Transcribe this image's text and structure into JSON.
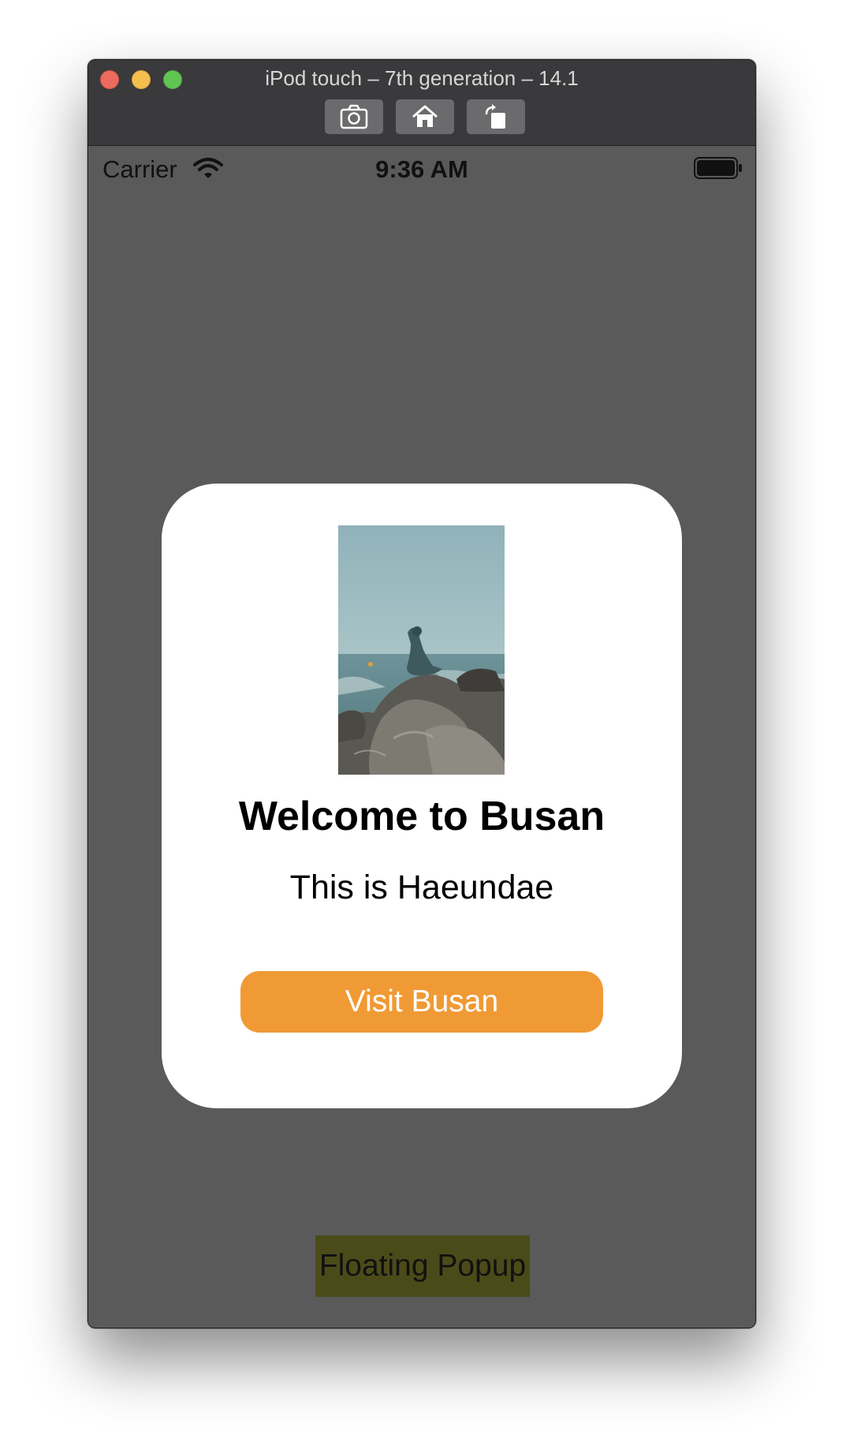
{
  "window": {
    "title": "iPod touch – 7th generation – 14.1",
    "toolbar": {
      "screenshot_icon": "camera-icon",
      "home_icon": "home-icon",
      "rotate_icon": "rotate-icon"
    }
  },
  "status_bar": {
    "carrier": "Carrier",
    "time": "9:36 AM",
    "wifi_icon": "wifi-icon",
    "battery_icon": "battery-icon"
  },
  "popup": {
    "image": "haeundae-mermaid-statue-photo",
    "title": "Welcome to Busan",
    "subtitle": "This is Haeundae",
    "button_label": "Visit Busan",
    "button_color": "#f09a35"
  },
  "floating_popup": {
    "label": "Floating Popup",
    "background": "#4b4b19"
  },
  "colors": {
    "screen_background": "#5a5a5a",
    "titlebar": "#3a3a3c",
    "popup_background": "#ffffff"
  }
}
